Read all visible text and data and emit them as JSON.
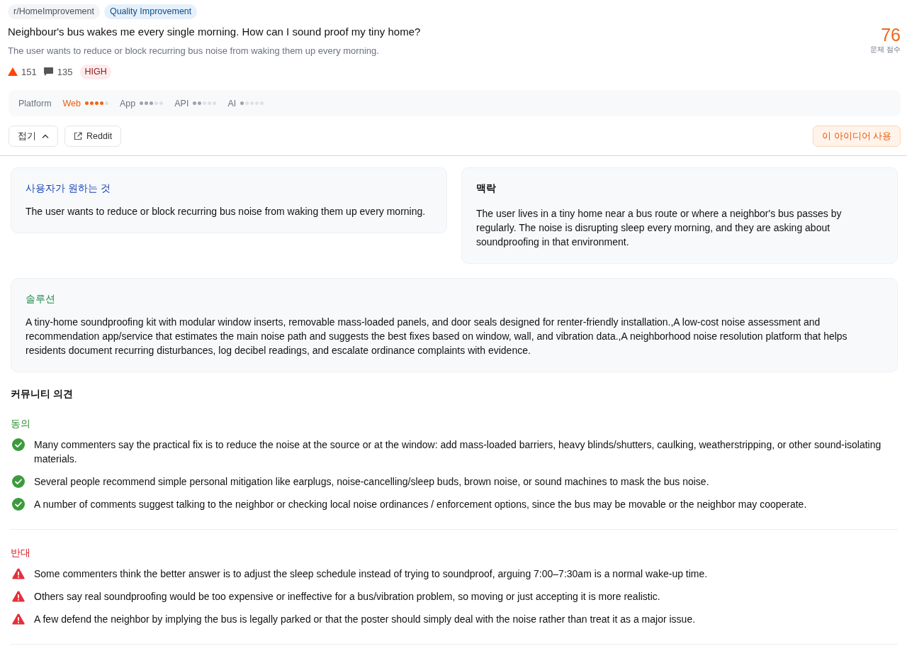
{
  "tags": [
    {
      "label": "r/HomeImprovement",
      "kind": "subreddit"
    },
    {
      "label": "Quality Improvement",
      "kind": "category"
    }
  ],
  "title": "Neighbour's bus wakes me every single morning. How can I sound proof my tiny home?",
  "summary": "The user wants to reduce or block recurring bus noise from waking them up every morning.",
  "score": {
    "value": "76",
    "label": "문제 점수"
  },
  "stats": {
    "upvotes": "151",
    "comments": "135",
    "priority": "HIGH"
  },
  "platform": {
    "label": "Platform",
    "items": [
      {
        "name": "Web",
        "stars": 4,
        "selected": true
      },
      {
        "name": "App",
        "stars": 3,
        "selected": false
      },
      {
        "name": "API",
        "stars": 2,
        "selected": false
      },
      {
        "name": "AI",
        "stars": 1,
        "selected": false
      }
    ]
  },
  "actions": {
    "collapse": "접기",
    "reddit": "Reddit",
    "use_idea": "이 아이디어 사용"
  },
  "cards": [
    {
      "kind": "want",
      "title": "사용자가 원하는 것",
      "text": "The user wants to reduce or block recurring bus noise from waking them up every morning."
    },
    {
      "kind": "context",
      "title": "맥락",
      "text": "The user lives in a tiny home near a bus route or where a neighbor's bus passes by regularly. The noise is disrupting sleep every morning, and they are asking about soundproofing in that environment."
    },
    {
      "kind": "solution",
      "title": "솔루션",
      "text": "A tiny-home soundproofing kit with modular window inserts, removable mass-loaded panels, and door seals designed for renter-friendly installation.,A low-cost noise assessment and recommendation app/service that estimates the main noise path and suggests the best fixes based on window, wall, and vibration data.,A neighborhood noise resolution platform that helps residents document recurring disturbances, log decibel readings, and escalate ordinance complaints with evidence."
    }
  ],
  "community": {
    "title": "커뮤니티 의견",
    "groups": [
      {
        "kind": "agree",
        "title": "동의",
        "items": [
          "Many commenters say the practical fix is to reduce the noise at the source or at the window: add mass-loaded barriers, heavy blinds/shutters, caulking, weatherstripping, or other sound-isolating materials.",
          "Several people recommend simple personal mitigation like earplugs, noise-cancelling/sleep buds, brown noise, or sound machines to mask the bus noise.",
          "A number of comments suggest talking to the neighbor or checking local noise ordinances / enforcement options, since the bus may be movable or the neighbor may cooperate."
        ]
      },
      {
        "kind": "disagree",
        "title": "반대",
        "items": [
          "Some commenters think the better answer is to adjust the sleep schedule instead of trying to soundproof, arguing 7:00–7:30am is a normal wake-up time.",
          "Others say real soundproofing would be too expensive or ineffective for a bus/vibration problem, so moving or just accepting it is more realistic.",
          "A few defend the neighbor by implying the bus is legally parked or that the poster should simply deal with the noise rather than treat it as a major issue."
        ]
      }
    ]
  }
}
